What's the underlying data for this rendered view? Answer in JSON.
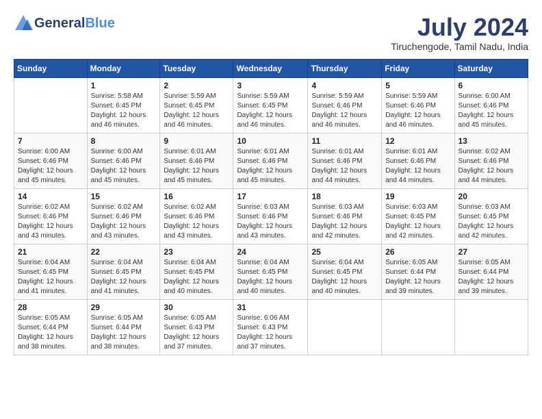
{
  "logo": {
    "general": "General",
    "blue": "Blue"
  },
  "header": {
    "month_title": "July 2024",
    "location": "Tiruchengode, Tamil Nadu, India"
  },
  "weekdays": [
    "Sunday",
    "Monday",
    "Tuesday",
    "Wednesday",
    "Thursday",
    "Friday",
    "Saturday"
  ],
  "weeks": [
    [
      {
        "day": "",
        "sunrise": "",
        "sunset": "",
        "daylight": ""
      },
      {
        "day": "1",
        "sunrise": "Sunrise: 5:58 AM",
        "sunset": "Sunset: 6:45 PM",
        "daylight": "Daylight: 12 hours and 46 minutes."
      },
      {
        "day": "2",
        "sunrise": "Sunrise: 5:59 AM",
        "sunset": "Sunset: 6:45 PM",
        "daylight": "Daylight: 12 hours and 46 minutes."
      },
      {
        "day": "3",
        "sunrise": "Sunrise: 5:59 AM",
        "sunset": "Sunset: 6:45 PM",
        "daylight": "Daylight: 12 hours and 46 minutes."
      },
      {
        "day": "4",
        "sunrise": "Sunrise: 5:59 AM",
        "sunset": "Sunset: 6:46 PM",
        "daylight": "Daylight: 12 hours and 46 minutes."
      },
      {
        "day": "5",
        "sunrise": "Sunrise: 5:59 AM",
        "sunset": "Sunset: 6:46 PM",
        "daylight": "Daylight: 12 hours and 46 minutes."
      },
      {
        "day": "6",
        "sunrise": "Sunrise: 6:00 AM",
        "sunset": "Sunset: 6:46 PM",
        "daylight": "Daylight: 12 hours and 45 minutes."
      }
    ],
    [
      {
        "day": "7",
        "sunrise": "Sunrise: 6:00 AM",
        "sunset": "Sunset: 6:46 PM",
        "daylight": "Daylight: 12 hours and 45 minutes."
      },
      {
        "day": "8",
        "sunrise": "Sunrise: 6:00 AM",
        "sunset": "Sunset: 6:46 PM",
        "daylight": "Daylight: 12 hours and 45 minutes."
      },
      {
        "day": "9",
        "sunrise": "Sunrise: 6:01 AM",
        "sunset": "Sunset: 6:46 PM",
        "daylight": "Daylight: 12 hours and 45 minutes."
      },
      {
        "day": "10",
        "sunrise": "Sunrise: 6:01 AM",
        "sunset": "Sunset: 6:46 PM",
        "daylight": "Daylight: 12 hours and 45 minutes."
      },
      {
        "day": "11",
        "sunrise": "Sunrise: 6:01 AM",
        "sunset": "Sunset: 6:46 PM",
        "daylight": "Daylight: 12 hours and 44 minutes."
      },
      {
        "day": "12",
        "sunrise": "Sunrise: 6:01 AM",
        "sunset": "Sunset: 6:46 PM",
        "daylight": "Daylight: 12 hours and 44 minutes."
      },
      {
        "day": "13",
        "sunrise": "Sunrise: 6:02 AM",
        "sunset": "Sunset: 6:46 PM",
        "daylight": "Daylight: 12 hours and 44 minutes."
      }
    ],
    [
      {
        "day": "14",
        "sunrise": "Sunrise: 6:02 AM",
        "sunset": "Sunset: 6:46 PM",
        "daylight": "Daylight: 12 hours and 43 minutes."
      },
      {
        "day": "15",
        "sunrise": "Sunrise: 6:02 AM",
        "sunset": "Sunset: 6:46 PM",
        "daylight": "Daylight: 12 hours and 43 minutes."
      },
      {
        "day": "16",
        "sunrise": "Sunrise: 6:02 AM",
        "sunset": "Sunset: 6:46 PM",
        "daylight": "Daylight: 12 hours and 43 minutes."
      },
      {
        "day": "17",
        "sunrise": "Sunrise: 6:03 AM",
        "sunset": "Sunset: 6:46 PM",
        "daylight": "Daylight: 12 hours and 43 minutes."
      },
      {
        "day": "18",
        "sunrise": "Sunrise: 6:03 AM",
        "sunset": "Sunset: 6:46 PM",
        "daylight": "Daylight: 12 hours and 42 minutes."
      },
      {
        "day": "19",
        "sunrise": "Sunrise: 6:03 AM",
        "sunset": "Sunset: 6:45 PM",
        "daylight": "Daylight: 12 hours and 42 minutes."
      },
      {
        "day": "20",
        "sunrise": "Sunrise: 6:03 AM",
        "sunset": "Sunset: 6:45 PM",
        "daylight": "Daylight: 12 hours and 42 minutes."
      }
    ],
    [
      {
        "day": "21",
        "sunrise": "Sunrise: 6:04 AM",
        "sunset": "Sunset: 6:45 PM",
        "daylight": "Daylight: 12 hours and 41 minutes."
      },
      {
        "day": "22",
        "sunrise": "Sunrise: 6:04 AM",
        "sunset": "Sunset: 6:45 PM",
        "daylight": "Daylight: 12 hours and 41 minutes."
      },
      {
        "day": "23",
        "sunrise": "Sunrise: 6:04 AM",
        "sunset": "Sunset: 6:45 PM",
        "daylight": "Daylight: 12 hours and 40 minutes."
      },
      {
        "day": "24",
        "sunrise": "Sunrise: 6:04 AM",
        "sunset": "Sunset: 6:45 PM",
        "daylight": "Daylight: 12 hours and 40 minutes."
      },
      {
        "day": "25",
        "sunrise": "Sunrise: 6:04 AM",
        "sunset": "Sunset: 6:45 PM",
        "daylight": "Daylight: 12 hours and 40 minutes."
      },
      {
        "day": "26",
        "sunrise": "Sunrise: 6:05 AM",
        "sunset": "Sunset: 6:44 PM",
        "daylight": "Daylight: 12 hours and 39 minutes."
      },
      {
        "day": "27",
        "sunrise": "Sunrise: 6:05 AM",
        "sunset": "Sunset: 6:44 PM",
        "daylight": "Daylight: 12 hours and 39 minutes."
      }
    ],
    [
      {
        "day": "28",
        "sunrise": "Sunrise: 6:05 AM",
        "sunset": "Sunset: 6:44 PM",
        "daylight": "Daylight: 12 hours and 38 minutes."
      },
      {
        "day": "29",
        "sunrise": "Sunrise: 6:05 AM",
        "sunset": "Sunset: 6:44 PM",
        "daylight": "Daylight: 12 hours and 38 minutes."
      },
      {
        "day": "30",
        "sunrise": "Sunrise: 6:05 AM",
        "sunset": "Sunset: 6:43 PM",
        "daylight": "Daylight: 12 hours and 37 minutes."
      },
      {
        "day": "31",
        "sunrise": "Sunrise: 6:06 AM",
        "sunset": "Sunset: 6:43 PM",
        "daylight": "Daylight: 12 hours and 37 minutes."
      },
      {
        "day": "",
        "sunrise": "",
        "sunset": "",
        "daylight": ""
      },
      {
        "day": "",
        "sunrise": "",
        "sunset": "",
        "daylight": ""
      },
      {
        "day": "",
        "sunrise": "",
        "sunset": "",
        "daylight": ""
      }
    ]
  ]
}
